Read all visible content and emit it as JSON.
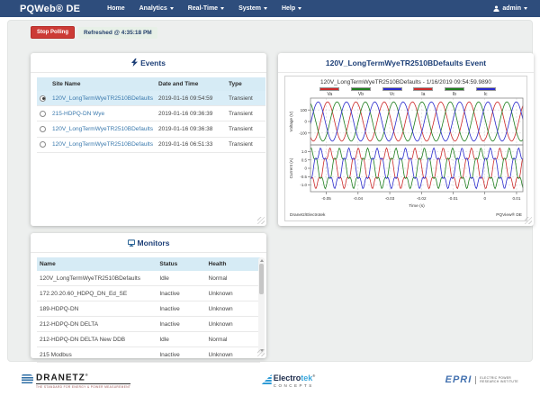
{
  "navbar": {
    "brand": "PQWeb® DE",
    "items": [
      {
        "label": "Home",
        "caret": false
      },
      {
        "label": "Analytics",
        "caret": true
      },
      {
        "label": "Real-Time",
        "caret": true
      },
      {
        "label": "System",
        "caret": true
      },
      {
        "label": "Help",
        "caret": true
      }
    ],
    "user": "admin"
  },
  "polling": {
    "stop_button": "Stop Polling",
    "refreshed": "Refreshed @ 4:35:18 PM"
  },
  "events_panel": {
    "title": "Events",
    "columns": [
      "Site Name",
      "Date and Time",
      "Type"
    ],
    "rows": [
      {
        "selected": true,
        "site": "120V_LongTermWyeTR2510BDefaults",
        "datetime": "2019-01-16 09:54:59",
        "type": "Transient"
      },
      {
        "selected": false,
        "site": "215-HDPQ-DN Wye",
        "datetime": "2019-01-16 09:36:39",
        "type": "Transient"
      },
      {
        "selected": false,
        "site": "120V_LongTermWyeTR2510BDefaults",
        "datetime": "2019-01-16 09:36:38",
        "type": "Transient"
      },
      {
        "selected": false,
        "site": "120V_LongTermWyeTR2510BDefaults",
        "datetime": "2019-01-16 06:51:33",
        "type": "Transient"
      }
    ]
  },
  "event_detail": {
    "title": "120V_LongTermWyeTR2510BDefaults Event"
  },
  "chart_data": {
    "type": "line",
    "title": "120V_LongTermWyeTR2510BDefaults - 1/16/2019 09:54:59.9890",
    "footer_left": "Dranetz/Electrotek",
    "footer_right": "PQView® DE",
    "legend": [
      {
        "name": "Va",
        "color": "#cc2a2a"
      },
      {
        "name": "Vb",
        "color": "#1e7e1e"
      },
      {
        "name": "Vc",
        "color": "#2a2acc"
      },
      {
        "name": "Ia",
        "color": "#cc2a2a"
      },
      {
        "name": "Ib",
        "color": "#1e7e1e"
      },
      {
        "name": "Ic",
        "color": "#2a2acc"
      }
    ],
    "xlabel": "Time (s)",
    "x_range": [
      -0.055,
      0.012
    ],
    "x_ticks": [
      {
        "v": -0.05,
        "l": "-0.05"
      },
      {
        "v": -0.04,
        "l": "-0.04"
      },
      {
        "v": -0.03,
        "l": "-0.03"
      },
      {
        "v": -0.02,
        "l": "-0.02"
      },
      {
        "v": -0.01,
        "l": "-0.01"
      },
      {
        "v": 0,
        "l": "0"
      },
      {
        "v": 0.01,
        "l": "0.01"
      }
    ],
    "frequency_hz": 112,
    "subplots": [
      {
        "ylabel": "Voltage (V)",
        "ylim": 195,
        "y_ticks": [
          {
            "v": 100,
            "l": "100"
          },
          {
            "v": 0,
            "l": "0"
          },
          {
            "v": -100,
            "l": "-100"
          }
        ],
        "series": [
          {
            "name": "Va",
            "color": "#cc2a2a",
            "amp": 170,
            "phase_deg": -70,
            "harm_order": 1,
            "harm_amp": 0
          },
          {
            "name": "Vb",
            "color": "#1e7e1e",
            "amp": 170,
            "phase_deg": 170,
            "harm_order": 1,
            "harm_amp": 0
          },
          {
            "name": "Vc",
            "color": "#2a2acc",
            "amp": 170,
            "phase_deg": 50,
            "harm_order": 1,
            "harm_amp": 0
          }
        ]
      },
      {
        "ylabel": "Current (A)",
        "ylim": 1.35,
        "y_ticks": [
          {
            "v": 1.0,
            "l": "1.0"
          },
          {
            "v": 0.5,
            "l": "0.5"
          },
          {
            "v": 0,
            "l": "0"
          },
          {
            "v": -0.5,
            "l": "-0.5"
          },
          {
            "v": -1.0,
            "l": "-1.0"
          }
        ],
        "series": [
          {
            "name": "Ia",
            "color": "#cc2a2a",
            "amp": 1.0,
            "phase_deg": -100,
            "harm_order": 5,
            "harm_amp": 0.22
          },
          {
            "name": "Ib",
            "color": "#1e7e1e",
            "amp": 1.0,
            "phase_deg": 140,
            "harm_order": 5,
            "harm_amp": 0.22
          },
          {
            "name": "Ic",
            "color": "#2a2acc",
            "amp": 1.0,
            "phase_deg": 20,
            "harm_order": 5,
            "harm_amp": 0.22
          }
        ]
      }
    ]
  },
  "monitors_panel": {
    "title": "Monitors",
    "columns": [
      "Name",
      "Status",
      "Health"
    ],
    "rows": [
      {
        "name": "120V_LongTermWyeTR2510BDefaults",
        "status": "Idle",
        "health": "Normal"
      },
      {
        "name": "172.20.20.60_HDPQ_DN_Ed_SE",
        "status": "Inactive",
        "health": "Unknown"
      },
      {
        "name": "189-HDPQ-DN",
        "status": "Inactive",
        "health": "Unknown"
      },
      {
        "name": "212-HDPQ-DN DELTA",
        "status": "Inactive",
        "health": "Unknown"
      },
      {
        "name": "212-HDPQ-DN DELTA New DDB",
        "status": "Idle",
        "health": "Normal"
      },
      {
        "name": "215 Modbus",
        "status": "Inactive",
        "health": "Unknown"
      }
    ]
  },
  "footer": {
    "dranetz": {
      "name": "DRANETZ",
      "reg": "®",
      "tagline": "THE STANDARD FOR ENERGY & POWER MEASUREMENT"
    },
    "electrotek": {
      "name_dark": "Electro",
      "name_light": "tek",
      "reg": "®",
      "sub": "CONCEPTS"
    },
    "epri": {
      "name": "EPRI",
      "lines": [
        "ELECTRIC POWER",
        "RESEARCH INSTITUTE"
      ]
    }
  },
  "colors": {
    "navbar": "#2e4d7c",
    "heading": "#1d3f77",
    "table_header_bg": "#d6ebf5",
    "selected_row_bg": "#d9edf7",
    "link": "#3a79ad",
    "stop_button": "#cc3b36"
  }
}
